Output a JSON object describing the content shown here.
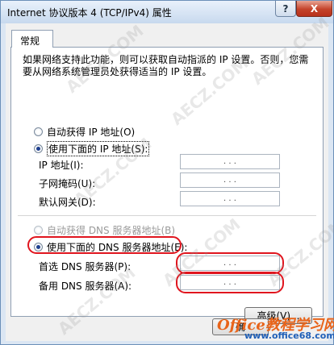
{
  "window": {
    "title": "Internet 协议版本 4 (TCP/IPv4) 属性",
    "help_glyph": "?",
    "close_glyph": "X"
  },
  "tabs": [
    {
      "label": "常规"
    }
  ],
  "description": "如果网络支持此功能，则可以获取自动指派的 IP 设置。否则，您需要从网络系统管理员处获得适当的 IP 设置。",
  "ip_section": {
    "auto_option": "自动获得 IP 地址(O)",
    "manual_option": "使用下面的 IP 地址(S):",
    "fields": [
      {
        "label": "IP 地址(I):",
        "dots": ".  .  ."
      },
      {
        "label": "子网掩码(U):",
        "dots": ".  .  ."
      },
      {
        "label": "默认网关(D):",
        "dots": ".  .  ."
      }
    ]
  },
  "dns_section": {
    "auto_option": "自动获得 DNS 服务器地址(B)",
    "manual_option": "使用下面的 DNS 服务器地址(E):",
    "fields": [
      {
        "label": "首选 DNS 服务器(P):",
        "dots": ".  .  ."
      },
      {
        "label": "备用 DNS 服务器(A):",
        "dots": ".  .  ."
      }
    ]
  },
  "buttons": {
    "advanced": "高级(V)...",
    "ok": "确"
  },
  "watermarks": {
    "diagonal": "AECZ.COM",
    "brand": "Office教程学习网",
    "url": "www.office68.com"
  },
  "colors": {
    "annotation": "#e0151e",
    "selected_radio": "#1e3f8f"
  }
}
